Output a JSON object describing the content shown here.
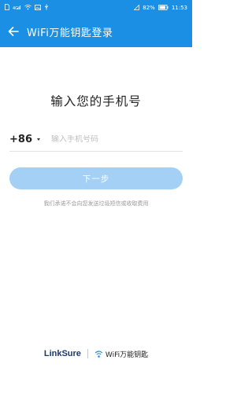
{
  "status_bar": {
    "battery_percent": "82%",
    "time": "11:53"
  },
  "app_bar": {
    "title": "WiFi万能钥匙登录"
  },
  "login": {
    "heading": "输入您的手机号",
    "country_code": "+86",
    "phone_placeholder": "输入手机号码",
    "next_label": "下一步",
    "disclaimer": "我们承诺不会向您发送垃圾短信或收取费用"
  },
  "footer": {
    "brand_left": "LinkSure",
    "brand_right": "WiFi万能钥匙"
  },
  "colors": {
    "primary": "#1a8fe3",
    "button_disabled": "#a3d0f4"
  }
}
